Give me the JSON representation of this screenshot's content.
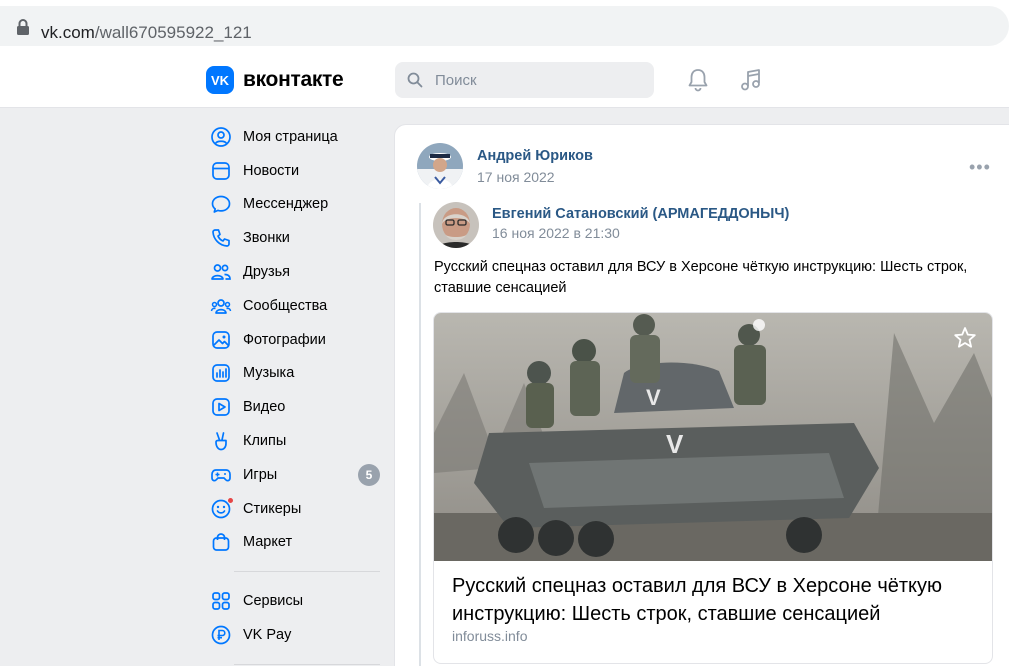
{
  "browser": {
    "url_host": "vk.com",
    "url_path": "/wall670595922_121"
  },
  "header": {
    "logo_text": "вконтакте",
    "logo_mark": "VK",
    "search_placeholder": "Поиск"
  },
  "nav": {
    "items": [
      {
        "label": "Моя страница",
        "icon": "user-circle-icon"
      },
      {
        "label": "Новости",
        "icon": "newsfeed-icon"
      },
      {
        "label": "Мессенджер",
        "icon": "message-bubble-icon"
      },
      {
        "label": "Звонки",
        "icon": "phone-icon"
      },
      {
        "label": "Друзья",
        "icon": "friends-icon"
      },
      {
        "label": "Сообщества",
        "icon": "communities-icon"
      },
      {
        "label": "Фотографии",
        "icon": "photo-icon"
      },
      {
        "label": "Музыка",
        "icon": "music-bars-icon"
      },
      {
        "label": "Видео",
        "icon": "video-play-icon"
      },
      {
        "label": "Клипы",
        "icon": "clips-hand-icon"
      },
      {
        "label": "Игры",
        "icon": "gamepad-icon",
        "badge": "5"
      },
      {
        "label": "Стикеры",
        "icon": "smile-icon"
      },
      {
        "label": "Маркет",
        "icon": "shopping-bag-icon"
      }
    ],
    "items2": [
      {
        "label": "Сервисы",
        "icon": "services-grid-icon"
      },
      {
        "label": "VK Pay",
        "icon": "ruble-icon"
      }
    ]
  },
  "post": {
    "author": "Андрей Юриков",
    "date": "17 ноя 2022",
    "more": "•••",
    "repost": {
      "author": "Евгений Сатановский (АРМАГЕДДОНЫЧ)",
      "date": "16 ноя 2022 в 21:30",
      "text": "Русский спецназ оставил для ВСУ в Херсоне чёткую инструкцию: Шесть строк, ставшие сенсацией"
    },
    "attachment": {
      "title": "Русский спецназ оставил для ВСУ в Херсоне чёткую инструкцию: Шесть строк, ставшие сенсацией",
      "source": "inforuss.info"
    }
  },
  "colors": {
    "accent": "#0077ff",
    "link": "#2a5885",
    "secondary": "#818c99",
    "bg": "#edeef0"
  }
}
